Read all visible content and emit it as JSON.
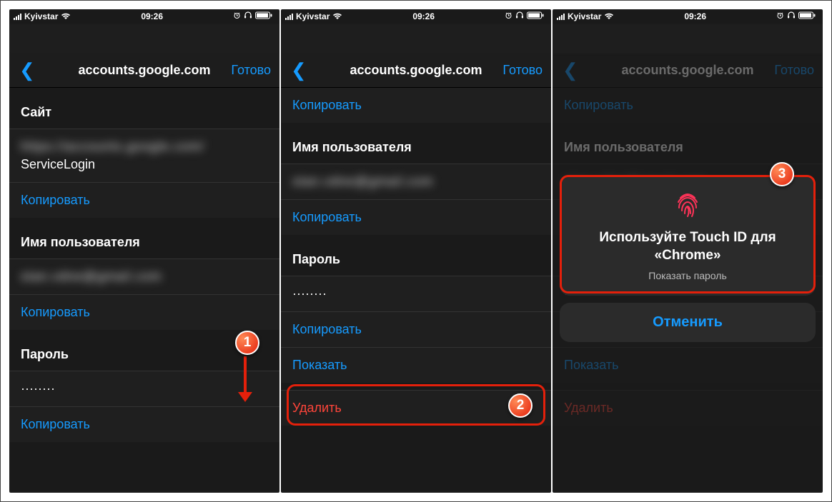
{
  "status": {
    "carrier": "Kyivstar",
    "time": "09:26"
  },
  "nav": {
    "title": "accounts.google.com",
    "done": "Готово"
  },
  "labels": {
    "site": "Сайт",
    "username": "Имя пользователя",
    "password": "Пароль",
    "copy": "Копировать",
    "show": "Показать",
    "delete": "Удалить",
    "url_blurred": "https://accounts.google.com/",
    "service": "ServiceLogin",
    "user_blurred": "stan.vdne@gmail.com",
    "dots": "········"
  },
  "touchid": {
    "title": "Используйте Touch ID для «Chrome»",
    "sub": "Показать пароль",
    "cancel": "Отменить"
  },
  "badges": {
    "one": "1",
    "two": "2",
    "three": "3"
  }
}
